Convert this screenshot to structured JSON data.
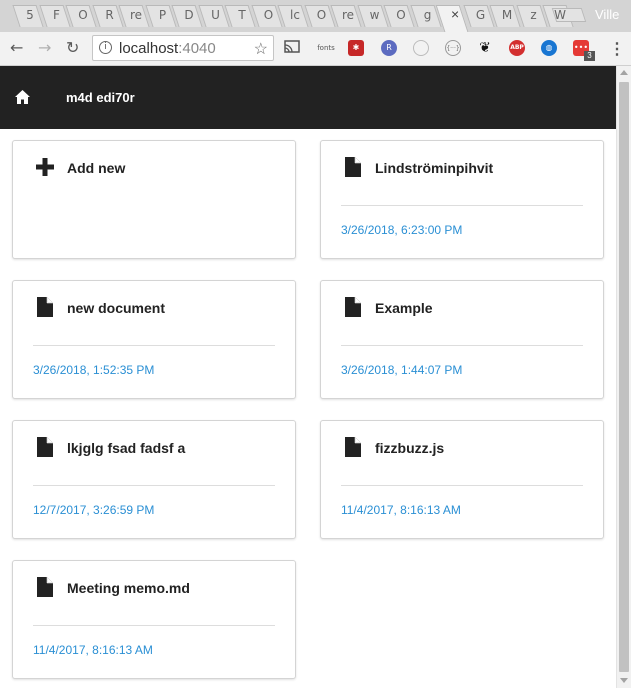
{
  "browser": {
    "tabs": [
      "5",
      "F",
      "O",
      "R",
      "re",
      "P",
      "D",
      "U",
      "T",
      "O",
      "lc",
      "O",
      "re",
      "w",
      "O",
      "g",
      "",
      "G",
      "M",
      "z",
      "W"
    ],
    "active_tab_close": "×",
    "profile_name": "Ville",
    "url_host": "localhost",
    "url_port": ":4040",
    "extensions": [
      "cast-icon",
      "fonts",
      "pesticide",
      "R",
      "timer",
      "code",
      "gnome",
      "ABP",
      "globe",
      "dots"
    ],
    "extension_labels": {
      "fonts": "fonts",
      "R": "R",
      "ABP": "ABP",
      "code": "{···}",
      "dots": "•••"
    },
    "extension_badge": "3"
  },
  "app": {
    "brand": "m4d edi70r"
  },
  "cards": [
    {
      "title": "Add new",
      "type": "add",
      "date": ""
    },
    {
      "title": "Lindströminpihvit",
      "type": "doc",
      "date": "3/26/2018, 6:23:00 PM"
    },
    {
      "title": "new document",
      "type": "doc",
      "date": "3/26/2018, 1:52:35 PM"
    },
    {
      "title": "Example",
      "type": "doc",
      "date": "3/26/2018, 1:44:07 PM"
    },
    {
      "title": "lkjglg fsad fadsf a",
      "type": "doc",
      "date": "12/7/2017, 3:26:59 PM"
    },
    {
      "title": "fizzbuzz.js",
      "type": "doc",
      "date": "11/4/2017, 8:16:13 AM"
    },
    {
      "title": "Meeting memo.md",
      "type": "doc",
      "date": "11/4/2017, 8:16:13 AM"
    }
  ],
  "colors": {
    "header_bg": "#222222",
    "date_link": "#2a8fd4",
    "card_border": "#d4d4d4"
  }
}
